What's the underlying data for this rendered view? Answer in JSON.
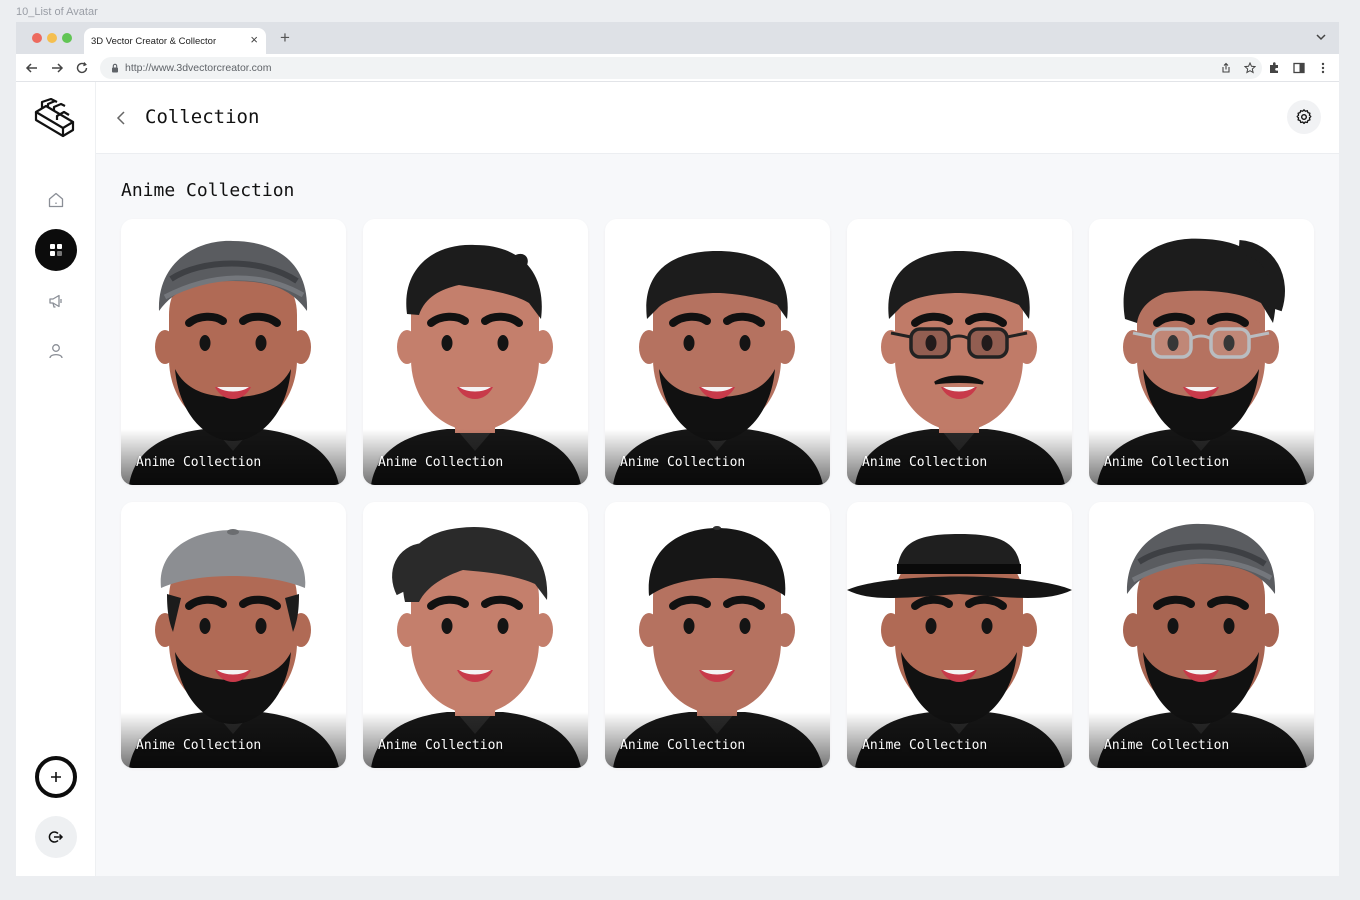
{
  "frame": {
    "label": "10_List of Avatar"
  },
  "browser": {
    "tab_title": "3D Vector Creator & Collector",
    "tab_close": "×",
    "new_tab": "+",
    "url": "http://www.3dvectorcreator.com"
  },
  "sidebar": {
    "items": [
      {
        "name": "home",
        "icon": "home-icon"
      },
      {
        "name": "collection",
        "icon": "grid-icon",
        "active": true
      },
      {
        "name": "announcements",
        "icon": "megaphone-icon"
      },
      {
        "name": "profile",
        "icon": "user-icon"
      }
    ],
    "add_icon": "plus-icon",
    "logout_icon": "logout-icon"
  },
  "header": {
    "title": "Collection"
  },
  "section": {
    "title": "Anime Collection"
  },
  "cards": [
    {
      "label": "Anime Collection",
      "hat": "turban",
      "beard": "full",
      "glasses": "none",
      "mustache": false,
      "skin": "#b06a55"
    },
    {
      "label": "Anime Collection",
      "hat": "spiky",
      "beard": "none",
      "glasses": "none",
      "mustache": false,
      "skin": "#c47f6c"
    },
    {
      "label": "Anime Collection",
      "hat": "short",
      "beard": "full",
      "glasses": "none",
      "mustache": false,
      "skin": "#b57260"
    },
    {
      "label": "Anime Collection",
      "hat": "short",
      "beard": "none",
      "glasses": "dark",
      "mustache": true,
      "skin": "#c07b68"
    },
    {
      "label": "Anime Collection",
      "hat": "wavy",
      "beard": "full",
      "glasses": "silver",
      "mustache": false,
      "skin": "#b57260"
    },
    {
      "label": "Anime Collection",
      "hat": "flatcap",
      "beard": "full",
      "glasses": "none",
      "mustache": false,
      "skin": "#b06a55"
    },
    {
      "label": "Anime Collection",
      "hat": "quiff",
      "beard": "none",
      "glasses": "none",
      "mustache": false,
      "skin": "#c47f6c"
    },
    {
      "label": "Anime Collection",
      "hat": "cap",
      "beard": "none",
      "glasses": "none",
      "mustache": false,
      "skin": "#b57260"
    },
    {
      "label": "Anime Collection",
      "hat": "fedora",
      "beard": "full",
      "glasses": "none",
      "mustache": false,
      "skin": "#b06a55"
    },
    {
      "label": "Anime Collection",
      "hat": "turban",
      "beard": "full",
      "glasses": "none",
      "mustache": false,
      "skin": "#a86552"
    }
  ],
  "colors": {
    "accent": "#0c0c0c",
    "background": "#f7f8fa",
    "hair": "#1c1c1c",
    "turban": "#5a5c60"
  }
}
